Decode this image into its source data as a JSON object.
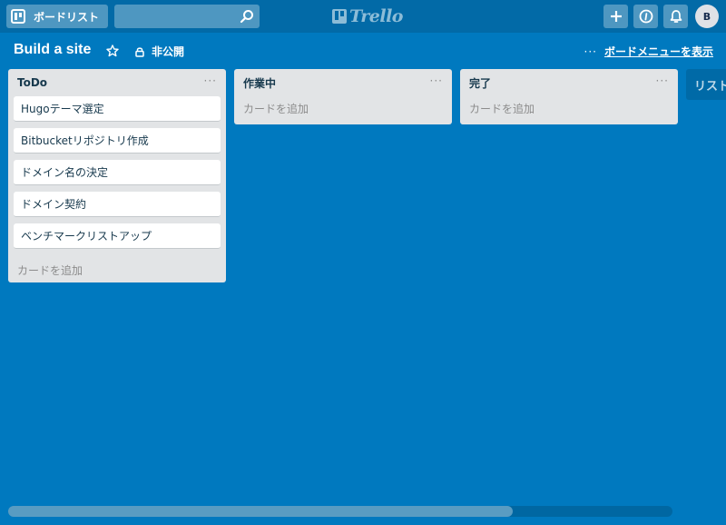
{
  "header": {
    "boards_label": "ボードリスト",
    "search": {
      "value": "",
      "placeholder": ""
    },
    "logo_text": "Trello",
    "avatar_initial": "B"
  },
  "board": {
    "title": "Build a site",
    "visibility": "非公開",
    "menu_dots": "···",
    "menu_label": "ボードメニューを表示"
  },
  "lists": [
    {
      "title": "ToDo",
      "menu": "···",
      "cards": [
        "Hugoテーマ選定",
        "Bitbucketリポジトリ作成",
        "ドメイン名の決定",
        "ドメイン契約",
        "ベンチマークリストアップ"
      ],
      "add_card": "カードを追加"
    },
    {
      "title": "作業中",
      "menu": "···",
      "cards": [],
      "add_card": "カードを追加"
    },
    {
      "title": "完了",
      "menu": "···",
      "cards": [],
      "add_card": "カードを追加"
    }
  ],
  "add_list_label": "リストを追加",
  "scrollbar": {
    "position_fraction": 0.76
  },
  "colors": {
    "board_background": "#0079bf",
    "header_background": "#026aa7",
    "list_background": "#e2e4e6"
  },
  "icons": [
    "boards-icon",
    "search-icon",
    "trello-logo-icon",
    "plus-icon",
    "info-icon",
    "bell-icon",
    "star-icon",
    "lock-icon"
  ]
}
